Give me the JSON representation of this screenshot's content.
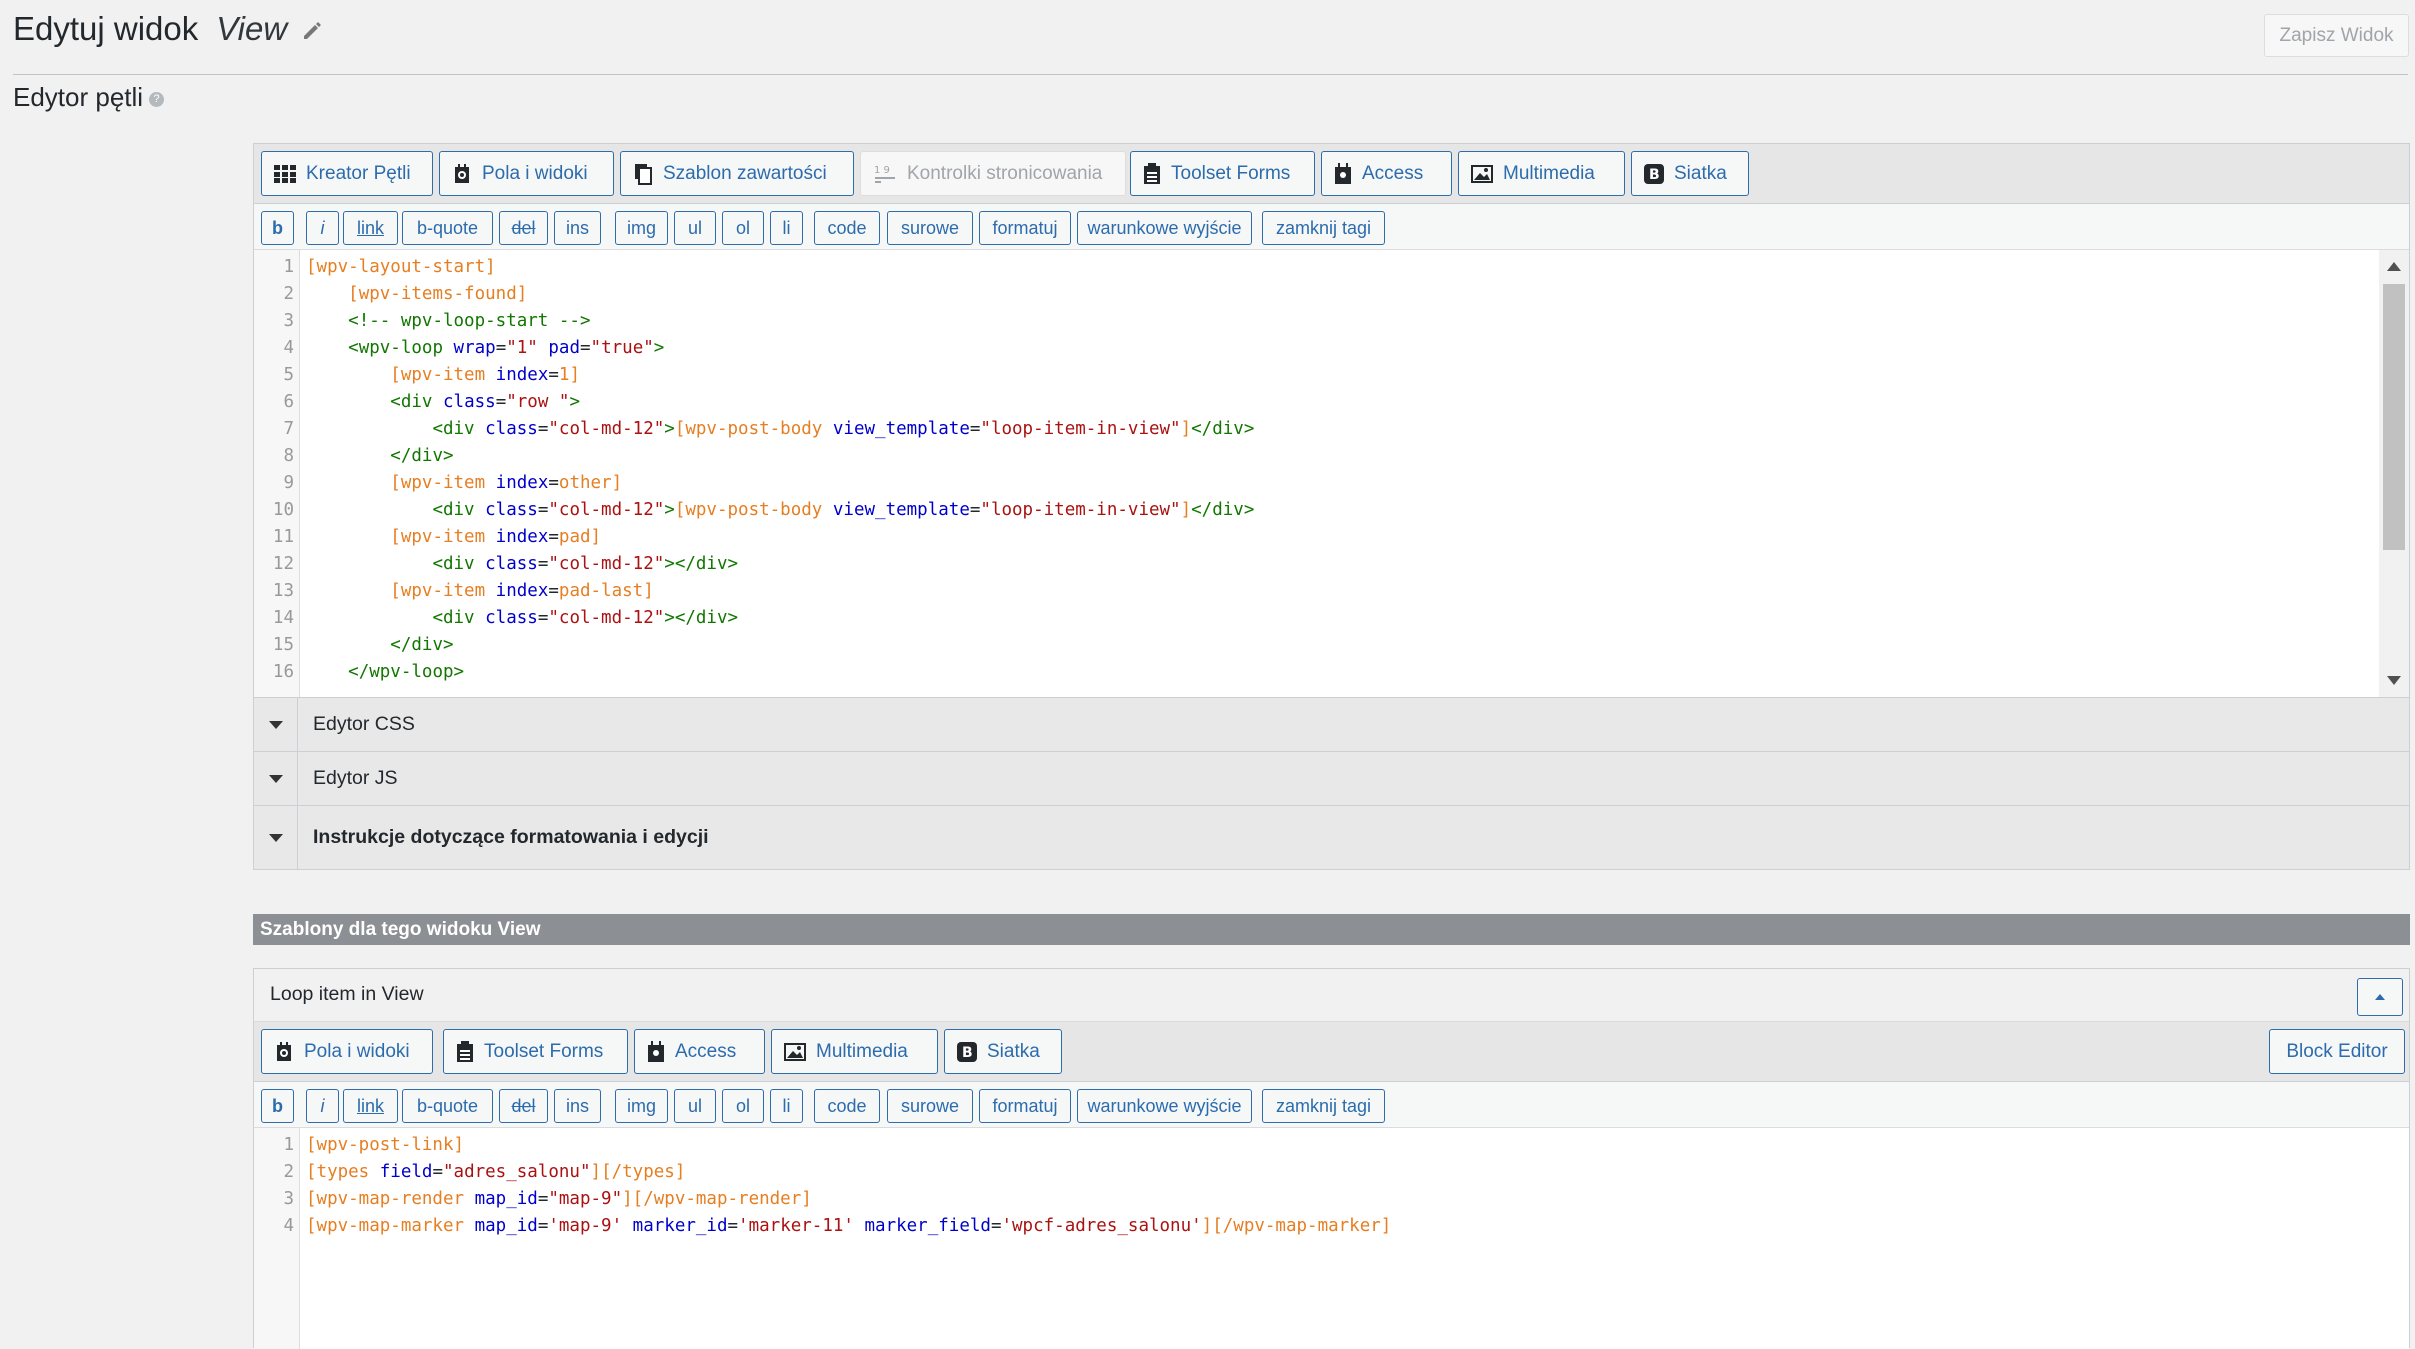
{
  "header": {
    "title": "Edytuj widok",
    "view_name": "View",
    "save_button": "Zapisz Widok"
  },
  "loop_editor": {
    "label": "Edytor pętli",
    "help": "?",
    "toolbar": [
      {
        "label": "Kreator Pętli",
        "icon": "grid-icon"
      },
      {
        "label": "Pola i widoki",
        "icon": "toolset-fields-icon"
      },
      {
        "label": "Szablon zawartości",
        "icon": "content-template-icon"
      },
      {
        "label": "Kontrolki stronicowania",
        "icon": "pagination-icon",
        "disabled": true
      },
      {
        "label": "Toolset Forms",
        "icon": "forms-icon"
      },
      {
        "label": "Access",
        "icon": "access-icon"
      },
      {
        "label": "Multimedia",
        "icon": "image-icon"
      },
      {
        "label": "Siatka",
        "icon": "bootstrap-icon"
      }
    ],
    "quicktags": [
      "b",
      "i",
      "link",
      "b-quote",
      "del",
      "ins",
      "img",
      "ul",
      "ol",
      "li",
      "code",
      "surowe",
      "formatuj",
      "warunkowe wyjście",
      "zamknij tagi"
    ],
    "code_lines": [
      "[wpv-layout-start]",
      "    [wpv-items-found]",
      "    <!-- wpv-loop-start -->",
      "    <wpv-loop wrap=\"1\" pad=\"true\">",
      "        [wpv-item index=1]",
      "        <div class=\"row \">",
      "            <div class=\"col-md-12\">[wpv-post-body view_template=\"loop-item-in-view\"]</div>",
      "        </div>",
      "        [wpv-item index=other]",
      "            <div class=\"col-md-12\">[wpv-post-body view_template=\"loop-item-in-view\"]</div>",
      "        [wpv-item index=pad]",
      "            <div class=\"col-md-12\"></div>",
      "        [wpv-item index=pad-last]",
      "            <div class=\"col-md-12\"></div>",
      "        </div>",
      "    </wpv-loop>"
    ]
  },
  "accordions": [
    {
      "label": "Edytor CSS",
      "bold": false
    },
    {
      "label": "Edytor JS",
      "bold": false
    },
    {
      "label": "Instrukcje dotyczące formatowania i edycji",
      "bold": true
    }
  ],
  "templates": {
    "section_title": "Szablony dla tego widoku View",
    "item": {
      "title": "Loop item in View",
      "toolbar": [
        {
          "label": "Pola i widoki",
          "icon": "toolset-fields-icon"
        },
        {
          "label": "Toolset Forms",
          "icon": "forms-icon"
        },
        {
          "label": "Access",
          "icon": "access-icon"
        },
        {
          "label": "Multimedia",
          "icon": "image-icon"
        },
        {
          "label": "Siatka",
          "icon": "bootstrap-icon"
        }
      ],
      "block_editor": "Block Editor",
      "code_lines": [
        "[wpv-post-link]",
        "[types field=\"adres_salonu\"][/types]",
        "[wpv-map-render map_id=\"map-9\"][/wpv-map-render]",
        "[wpv-map-marker map_id='map-9' marker_id='marker-11' marker_field='wpcf-adres_salonu'][/wpv-map-marker]"
      ]
    }
  },
  "colors": {
    "accent": "#2c6cad",
    "shortcode": "#e67e22",
    "attribute": "#0000cc",
    "string": "#aa1111",
    "html_tag": "#117700"
  }
}
